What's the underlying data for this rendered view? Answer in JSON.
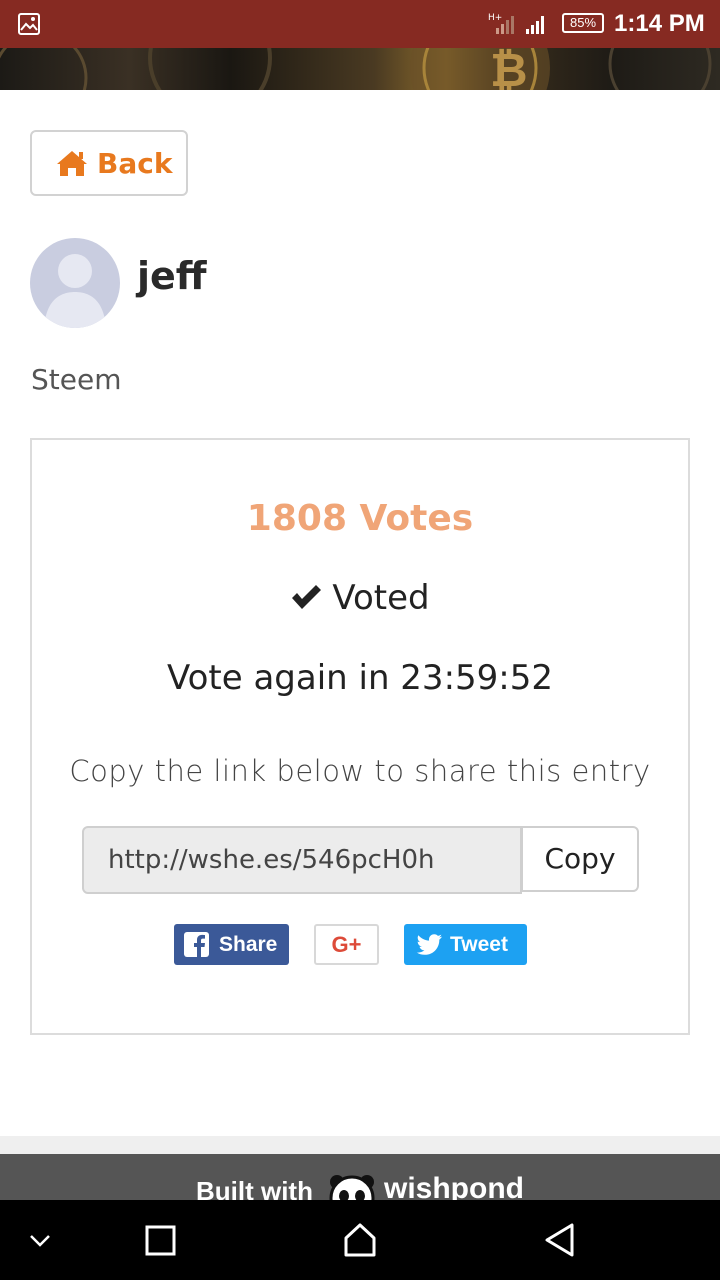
{
  "status_bar": {
    "battery": "85%",
    "time": "1:14 PM"
  },
  "back_button": {
    "label": "Back"
  },
  "profile": {
    "username": "jeff"
  },
  "entry": {
    "category": "Steem"
  },
  "vote_card": {
    "vote_count": "1808 Votes",
    "voted_label": "Voted",
    "countdown": "Vote again in 23:59:52",
    "share_instructions": "Copy the link below to share this entry",
    "share_link": "http://wshe.es/546pcH0h",
    "copy_label": "Copy"
  },
  "share_buttons": {
    "facebook_label": "Share",
    "gplus_label": "G+",
    "twitter_label": "Tweet"
  },
  "footer": {
    "built_with": "Built with",
    "brand": "wishpond"
  },
  "colors": {
    "status_bar": "#862a22",
    "accent_orange": "#e8791e",
    "vote_count": "#f0a577",
    "facebook": "#3b5998",
    "twitter": "#1da1f2",
    "gplus": "#dd4b39"
  }
}
